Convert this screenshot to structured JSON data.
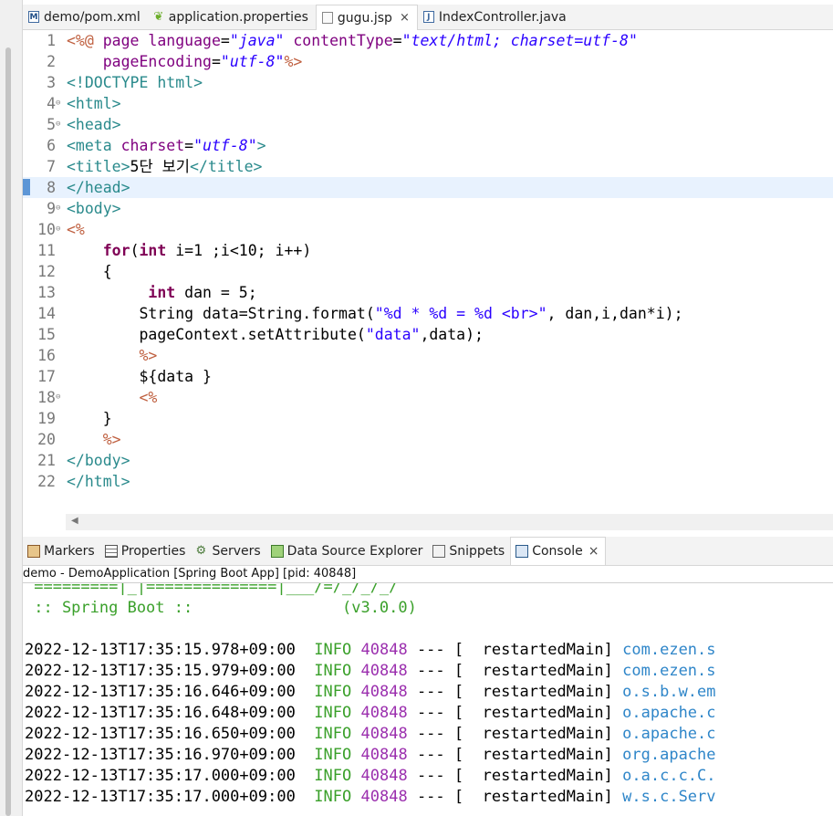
{
  "tabs": [
    {
      "label": "demo/pom.xml",
      "icon": "maven-file-icon"
    },
    {
      "label": "application.properties",
      "icon": "spring-leaf-icon"
    },
    {
      "label": "gugu.jsp",
      "icon": "jsp-file-icon",
      "active": true,
      "close": "×"
    },
    {
      "label": "IndexController.java",
      "icon": "java-file-icon"
    }
  ],
  "editor": {
    "line_numbers": [
      "1",
      "2",
      "3",
      "4",
      "5",
      "6",
      "7",
      "8",
      "9",
      "10",
      "11",
      "12",
      "13",
      "14",
      "15",
      "16",
      "17",
      "18",
      "19",
      "20",
      "21",
      "22"
    ],
    "lines": [
      "<%@ page language=\"java\" contentType=\"text/html; charset=utf-8\"",
      "    pageEncoding=\"utf-8\"%>",
      "<!DOCTYPE html>",
      "<html>",
      "<head>",
      "<meta charset=\"utf-8\">",
      "<title>5단 보기</title>",
      "</head>",
      "<body>",
      "<%",
      "    for(int i=1 ;i<10; i++)",
      "    {",
      "        int dan = 5;",
      "        String data=String.format(\"%d * %d = %d <br>\", dan,i,dan*i);",
      "        pageContext.setAttribute(\"data\",data);",
      "        %>",
      "        ${data }",
      "        <%",
      "    }",
      "    %>",
      "</body>",
      "</html>"
    ]
  },
  "views": [
    {
      "label": "Markers",
      "icon": "markers-icon"
    },
    {
      "label": "Properties",
      "icon": "properties-icon"
    },
    {
      "label": "Servers",
      "icon": "servers-icon"
    },
    {
      "label": "Data Source Explorer",
      "icon": "data-source-icon"
    },
    {
      "label": "Snippets",
      "icon": "snippets-icon"
    },
    {
      "label": "Console",
      "icon": "console-icon",
      "active": true,
      "close": "×"
    }
  ],
  "console": {
    "title": "demo - DemoApplication [Spring Boot App]  [pid: 40848]",
    "banner_line": " =========|_|==============|___/=/_/_/_/",
    "spring_line": " :: Spring Boot ::                (v3.0.0)",
    "logs": [
      {
        "ts": "2022-12-13T17:35:15.978+09:00",
        "level": "INFO",
        "pid": "40848",
        "sep": "---",
        "thread": "[  restartedMain]",
        "logger": "com.ezen.s"
      },
      {
        "ts": "2022-12-13T17:35:15.979+09:00",
        "level": "INFO",
        "pid": "40848",
        "sep": "---",
        "thread": "[  restartedMain]",
        "logger": "com.ezen.s"
      },
      {
        "ts": "2022-12-13T17:35:16.646+09:00",
        "level": "INFO",
        "pid": "40848",
        "sep": "---",
        "thread": "[  restartedMain]",
        "logger": "o.s.b.w.em"
      },
      {
        "ts": "2022-12-13T17:35:16.648+09:00",
        "level": "INFO",
        "pid": "40848",
        "sep": "---",
        "thread": "[  restartedMain]",
        "logger": "o.apache.c"
      },
      {
        "ts": "2022-12-13T17:35:16.650+09:00",
        "level": "INFO",
        "pid": "40848",
        "sep": "---",
        "thread": "[  restartedMain]",
        "logger": "o.apache.c"
      },
      {
        "ts": "2022-12-13T17:35:16.970+09:00",
        "level": "INFO",
        "pid": "40848",
        "sep": "---",
        "thread": "[  restartedMain]",
        "logger": "org.apache"
      },
      {
        "ts": "2022-12-13T17:35:17.000+09:00",
        "level": "INFO",
        "pid": "40848",
        "sep": "---",
        "thread": "[  restartedMain]",
        "logger": "o.a.c.c.C."
      },
      {
        "ts": "2022-12-13T17:35:17.000+09:00",
        "level": "INFO",
        "pid": "40848",
        "sep": "---",
        "thread": "[  restartedMain]",
        "logger": "w.s.c.Serv"
      }
    ]
  }
}
